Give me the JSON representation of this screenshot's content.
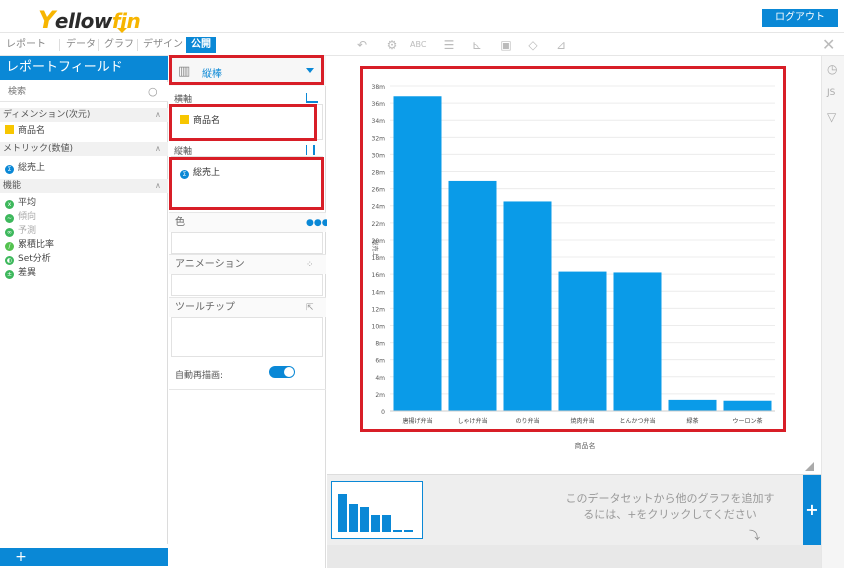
{
  "brand": {
    "logo_y": "Y",
    "logo_ellow": "ellow",
    "logo_fin": "fin",
    "logout": "ログアウト"
  },
  "tabs": [
    "レポート",
    "データ",
    "グラフ",
    "デザイン",
    "公開"
  ],
  "field_panel": {
    "title": "レポートフィールド",
    "search_placeholder": "検索",
    "sections": {
      "dimension": "ディメンション(次元)",
      "metric": "メトリック(数値)",
      "functions": "機能"
    },
    "dimension_items": [
      "商品名"
    ],
    "metric_items": [
      "総売上"
    ],
    "function_items": [
      {
        "label": "平均",
        "icon": "average-icon",
        "dim": false
      },
      {
        "label": "傾向",
        "icon": "trend-icon",
        "dim": true
      },
      {
        "label": "予測",
        "icon": "forecast-icon",
        "dim": true
      },
      {
        "label": "累積比率",
        "icon": "cumulative-icon",
        "dim": false
      },
      {
        "label": "Set分析",
        "icon": "set-analysis-icon",
        "dim": false
      },
      {
        "label": "差異",
        "icon": "difference-icon",
        "dim": false
      }
    ]
  },
  "config": {
    "chart_type": "縦棒",
    "horizontal_axis": "横軸",
    "horizontal_field": "商品名",
    "vertical_axis": "縦軸",
    "vertical_field": "総売上",
    "color": "色",
    "animation": "アニメーション",
    "tooltip": "ツールチップ",
    "auto_redraw": "自動再描画:",
    "auto_redraw_on": true
  },
  "rail": {
    "js": "JS"
  },
  "add_hint": {
    "line1": "このデータセットから他のグラフを追加す",
    "line2": "るには、+をクリックしてください"
  },
  "chart_data": {
    "type": "bar",
    "categories": [
      "唐揚げ弁当",
      "しゃけ弁当",
      "のり弁当",
      "焼肉弁当",
      "とんかつ弁当",
      "緑茶",
      "ウーロン茶"
    ],
    "values": [
      36.8,
      26.9,
      24.5,
      16.3,
      16.2,
      1.3,
      1.2
    ],
    "xlabel": "商品名",
    "ylabel": "総売上",
    "ylim": [
      0,
      38
    ],
    "yticks": [
      "0",
      "2m",
      "4m",
      "6m",
      "8m",
      "10m",
      "12m",
      "14m",
      "16m",
      "18m",
      "20m",
      "22m",
      "24m",
      "26m",
      "28m",
      "30m",
      "32m",
      "34m",
      "36m",
      "38m"
    ],
    "color": "#0a9be8",
    "grid": true
  }
}
